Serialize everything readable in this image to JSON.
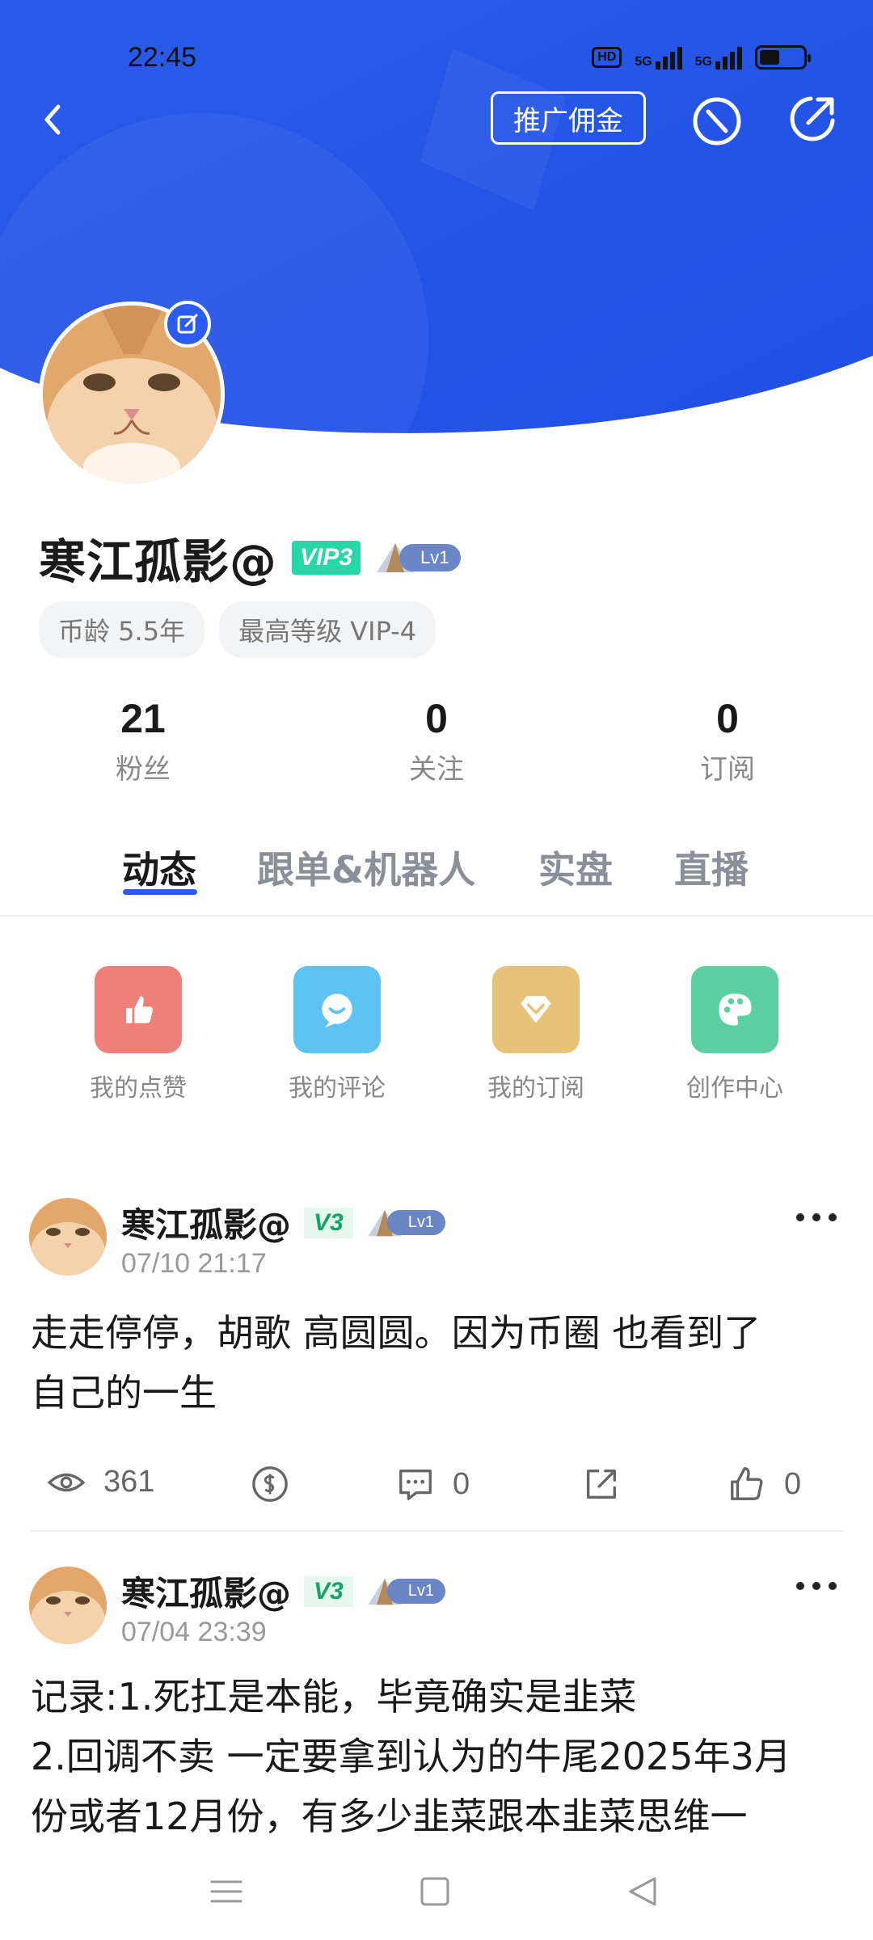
{
  "status_bar": {
    "time": "22:45",
    "hd": "HD",
    "net1": "5G",
    "net2": "5G"
  },
  "header": {
    "promo_label": "推广佣金",
    "bg_color": "#2b5cf0"
  },
  "profile": {
    "name": "寒江孤影@",
    "vip": "VIP3",
    "level": "Lv1",
    "tags": [
      "币龄 5.5年",
      "最高等级 VIP-4"
    ]
  },
  "stats": [
    {
      "value": "21",
      "label": "粉丝"
    },
    {
      "value": "0",
      "label": "关注"
    },
    {
      "value": "0",
      "label": "订阅"
    }
  ],
  "tabs": [
    "动态",
    "跟单&机器人",
    "实盘",
    "直播"
  ],
  "quick_actions": [
    {
      "label": "我的点赞",
      "icon": "thumbs-up-icon",
      "color": "#f07e79"
    },
    {
      "label": "我的评论",
      "icon": "comment-icon",
      "color": "#5cc3f2"
    },
    {
      "label": "我的订阅",
      "icon": "diamond-icon",
      "color": "#e9c27a"
    },
    {
      "label": "创作中心",
      "icon": "palette-icon",
      "color": "#5cd0a0"
    }
  ],
  "posts": [
    {
      "name": "寒江孤影@",
      "badge": "V3",
      "level": "Lv1",
      "time": "07/10 21:17",
      "lines": [
        "走走停停，胡歌  高圆圆。因为币圈   也看到了",
        "自己的一生"
      ],
      "views": "361",
      "comments": "0",
      "likes": "0"
    },
    {
      "name": "寒江孤影@",
      "badge": "V3",
      "level": "Lv1",
      "time": "07/04 23:39",
      "lines": [
        "记录:1.死扛是本能，毕竟确实是韭菜",
        "2.回调不卖  一定要拿到认为的牛尾2025年3月",
        "份或者12月份，有多少韭菜跟本韭菜思维一"
      ]
    }
  ]
}
